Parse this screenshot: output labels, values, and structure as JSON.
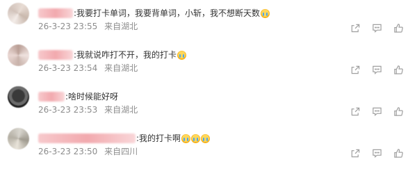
{
  "comments": [
    {
      "separator": ":",
      "text": "我要打卡单词，我要背单词，小斩，我不想断天数",
      "emoji_count": 1,
      "date": "26-3-23",
      "time": "23:55",
      "location": "来自湖北"
    },
    {
      "separator": ":",
      "text": "我就说咋打不开，我的打卡",
      "emoji_count": 1,
      "date": "26-3-23",
      "time": "23:54",
      "location": "来自湖北"
    },
    {
      "separator": ":",
      "text": "啥时候能好呀",
      "emoji_count": 0,
      "date": "26-3-23",
      "time": "23:53",
      "location": "来自湖北"
    },
    {
      "separator": ":",
      "text": "我的打卡啊",
      "emoji_count": 3,
      "date": "26-3-23",
      "time": "23:50",
      "location": "来自四川"
    }
  ],
  "icons": {
    "share": "share-icon",
    "comment": "comment-icon",
    "like": "like-icon",
    "emoji": "crying-emoji"
  },
  "colors": {
    "text": "#333333",
    "meta": "#8c8c8c",
    "icon": "#a0a0a0"
  }
}
